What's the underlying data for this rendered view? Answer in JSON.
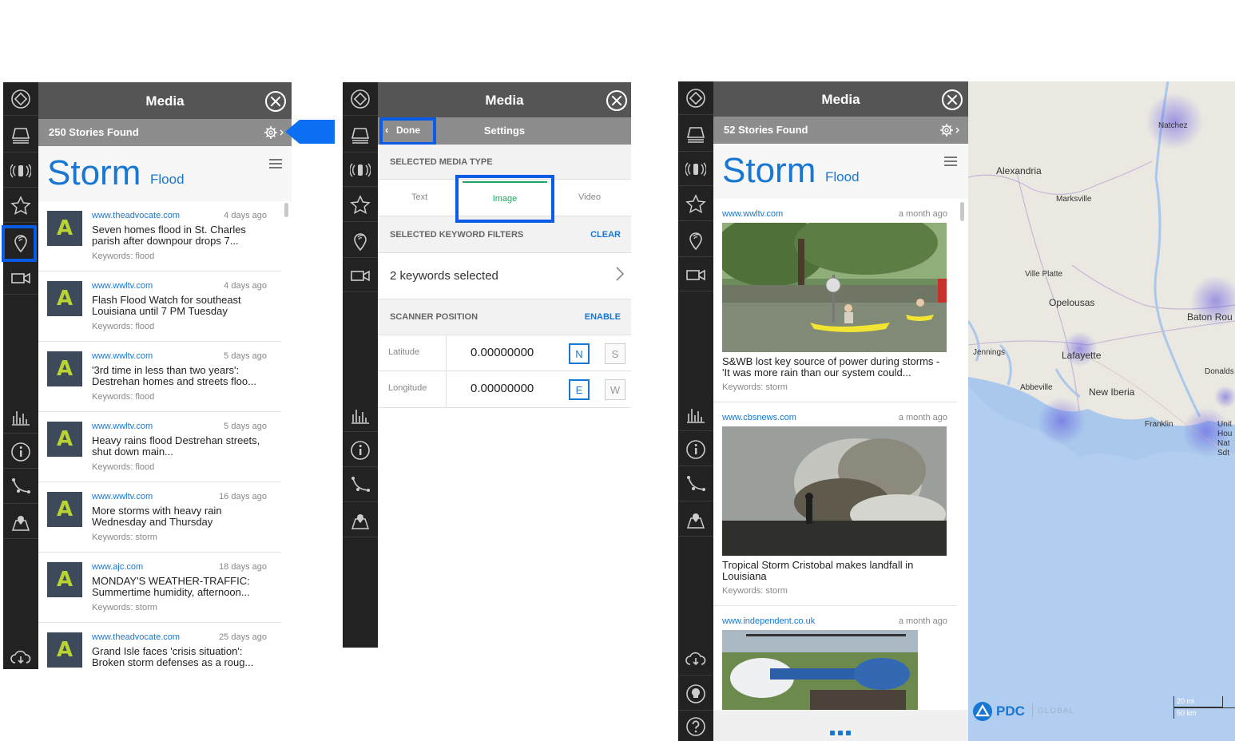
{
  "colors": {
    "accent": "#1877d2",
    "highlight": "#0a5ce6",
    "rail": "#222222",
    "header": "#555555",
    "subbar": "#8d8d8d",
    "logo_bg": "#3d4a5c",
    "logo_fg": "#b8d433"
  },
  "panel1": {
    "title": "Media",
    "stories_found": "250 Stories Found",
    "brand_main": "Storm",
    "brand_sub": "Flood",
    "items": [
      {
        "source": "www.theadvocate.com",
        "age": "4 days ago",
        "title": "Seven homes flood in St. Charles parish after downpour drops 7...",
        "keywords": "Keywords: flood"
      },
      {
        "source": "www.wwltv.com",
        "age": "4 days ago",
        "title": "Flash Flood Watch for southeast Louisiana until 7 PM Tuesday",
        "keywords": "Keywords: flood"
      },
      {
        "source": "www.wwltv.com",
        "age": "5 days ago",
        "title": "'3rd time in less than two years': Destrehan homes and streets floo...",
        "keywords": "Keywords: flood"
      },
      {
        "source": "www.wwltv.com",
        "age": "5 days ago",
        "title": "Heavy rains flood Destrehan streets, shut down main...",
        "keywords": "Keywords: flood"
      },
      {
        "source": "www.wwltv.com",
        "age": "16 days ago",
        "title": "More storms with heavy rain Wednesday and Thursday",
        "keywords": "Keywords: storm"
      },
      {
        "source": "www.ajc.com",
        "age": "18 days ago",
        "title": "MONDAY'S WEATHER-TRAFFIC: Summertime humidity, afternoon...",
        "keywords": "Keywords: storm"
      },
      {
        "source": "www.theadvocate.com",
        "age": "25 days ago",
        "title": "Grand Isle faces 'crisis situation': Broken storm defenses as a roug...",
        "keywords": ""
      }
    ]
  },
  "panel2": {
    "title": "Media",
    "done_label": "Done",
    "settings_label": "Settings",
    "media_type_heading": "SELECTED MEDIA TYPE",
    "media_tabs": [
      "Text",
      "Image",
      "Video"
    ],
    "selected_tab": "Image",
    "keyword_heading": "SELECTED KEYWORD FILTERS",
    "clear_label": "CLEAR",
    "keywords_selected": "2 keywords selected",
    "scanner_heading": "SCANNER POSITION",
    "enable_label": "ENABLE",
    "latitude_label": "Latitude",
    "latitude_value": "0.00000000",
    "longitude_label": "Longitude",
    "longitude_value": "0.00000000",
    "lat_dirs": [
      "N",
      "S"
    ],
    "lon_dirs": [
      "E",
      "W"
    ]
  },
  "panel3": {
    "title": "Media",
    "stories_found": "52 Stories Found",
    "brand_main": "Storm",
    "brand_sub": "Flood",
    "cards": [
      {
        "source": "www.wwltv.com",
        "age": "a month ago",
        "title": "S&WB lost key source of power during storms - 'It was more rain than our system could...",
        "keywords": "Keywords: storm"
      },
      {
        "source": "www.cbsnews.com",
        "age": "a month ago",
        "title": "Tropical Storm Cristobal makes landfall in Louisiana",
        "keywords": "Keywords: storm"
      },
      {
        "source": "www.independent.co.uk",
        "age": "a month ago",
        "title": "",
        "keywords": ""
      }
    ]
  },
  "map": {
    "places": [
      "Natchez",
      "Alexandria",
      "Marksville",
      "Ville Platte",
      "Opelousas",
      "Baton Rou",
      "Jennings",
      "Lafayette",
      "Donalds",
      "Abbeville",
      "New Iberia",
      "Franklin",
      "Unit",
      "Hou",
      "Nat",
      "Sdt"
    ],
    "logo": "PDC",
    "logo_suffix": "GLOBAL",
    "scale_mi": "20 mi",
    "scale_km": "50 km"
  }
}
